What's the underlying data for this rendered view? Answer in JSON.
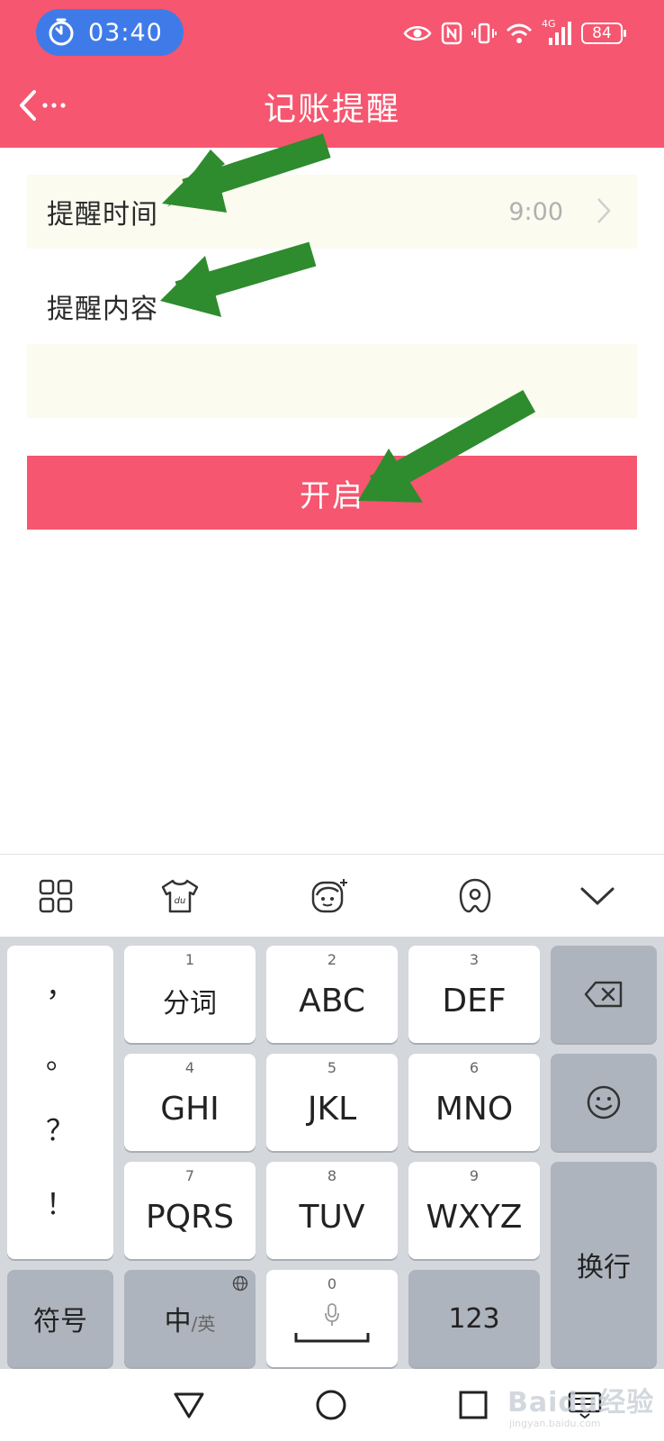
{
  "status_bar": {
    "time": "03:40",
    "battery": "84",
    "network": "4G"
  },
  "header": {
    "title": "记账提醒"
  },
  "reminder_time": {
    "label": "提醒时间",
    "value": "9:00"
  },
  "reminder_content": {
    "label": "提醒内容",
    "value": ""
  },
  "enable_button": {
    "label": "开启"
  },
  "keyboard": {
    "punctuation": [
      "，",
      "。",
      "？",
      "！"
    ],
    "keys": [
      {
        "num": "1",
        "label": "分词"
      },
      {
        "num": "2",
        "label": "ABC"
      },
      {
        "num": "3",
        "label": "DEF"
      },
      {
        "num": "4",
        "label": "GHI"
      },
      {
        "num": "5",
        "label": "JKL"
      },
      {
        "num": "6",
        "label": "MNO"
      },
      {
        "num": "7",
        "label": "PQRS"
      },
      {
        "num": "8",
        "label": "TUV"
      },
      {
        "num": "9",
        "label": "WXYZ"
      }
    ],
    "symbols_label": "符号",
    "lang_main": "中",
    "lang_alt": "/英",
    "space_num": "0",
    "numbers_label": "123",
    "enter_label": "换行"
  },
  "watermark": {
    "text": "Baidu经验",
    "sub": "jingyan.baidu.com"
  },
  "colors": {
    "accent": "#f6566f",
    "timer_pill": "#3f7be8",
    "row_bg": "#fbfbf0",
    "arrow": "#2e8b2e"
  }
}
